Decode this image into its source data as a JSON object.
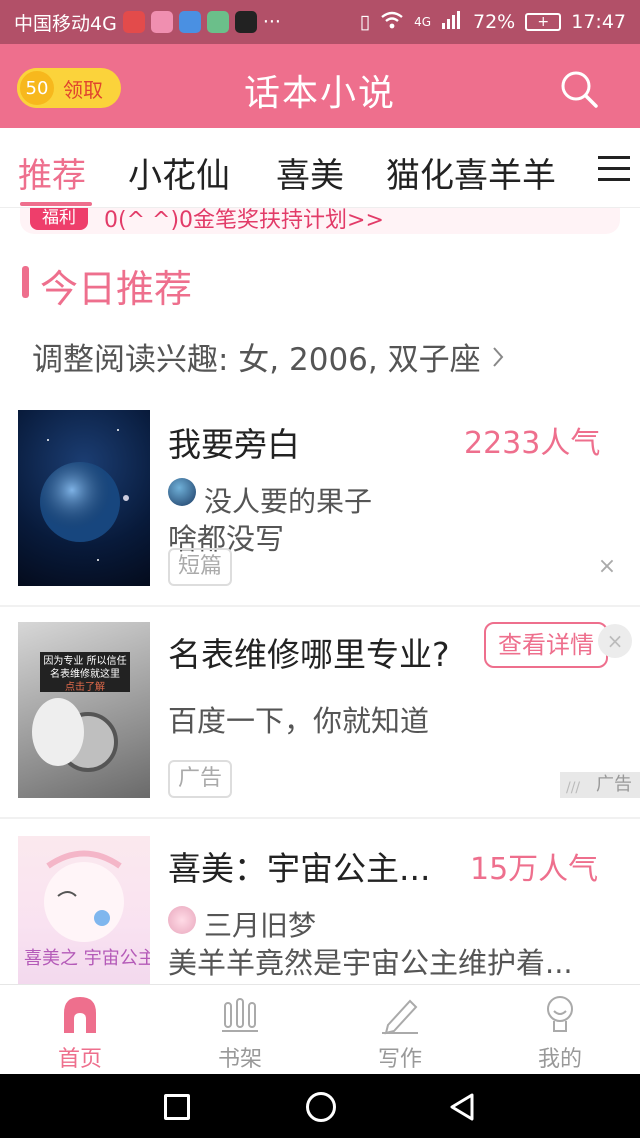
{
  "status_bar": {
    "carrier": "中国移动4G",
    "more": "···",
    "network": "4G",
    "battery": "72%",
    "time": "17:47"
  },
  "header": {
    "coins": "50",
    "reward_label": "领取",
    "title": "话本小说"
  },
  "tabs": [
    {
      "label": "推荐",
      "active": true
    },
    {
      "label": "小花仙"
    },
    {
      "label": "喜美"
    },
    {
      "label": "猫化喜羊羊"
    }
  ],
  "banner": {
    "tag": "福利",
    "text": "0(^        ^)0金笔奖扶持计划>>"
  },
  "section": {
    "title": "今日推荐",
    "interest": "调整阅读兴趣: 女, 2006, 双子座"
  },
  "books": [
    {
      "title": "我要旁白",
      "popularity": "2233人气",
      "author": "没人要的果子",
      "desc": "啥都没写",
      "tag": "短篇"
    },
    {
      "title": "名表维修哪里专业?",
      "desc": "百度一下，你就知道",
      "cta": "查看详情",
      "tag": "广告",
      "ad_mark": "广告",
      "cover_line1": "因为专业 所以信任",
      "cover_line2": "名表维修就这里",
      "cover_line3": "点击了解"
    },
    {
      "title": "喜美：宇宙公主...",
      "popularity": "15万人气",
      "author": "三月旧梦",
      "desc": "美羊羊竟然是宇宙公主维护着...",
      "cover_text": "喜美之 宇宙公主"
    }
  ],
  "bottom_nav": [
    {
      "label": "首页",
      "icon": "home-icon",
      "active": true
    },
    {
      "label": "书架",
      "icon": "bookshelf-icon"
    },
    {
      "label": "写作",
      "icon": "pencil-icon"
    },
    {
      "label": "我的",
      "icon": "profile-icon"
    }
  ],
  "colors": {
    "accent": "#ee6f8d",
    "status_bar": "#b25068",
    "gold": "#fbd33b"
  }
}
